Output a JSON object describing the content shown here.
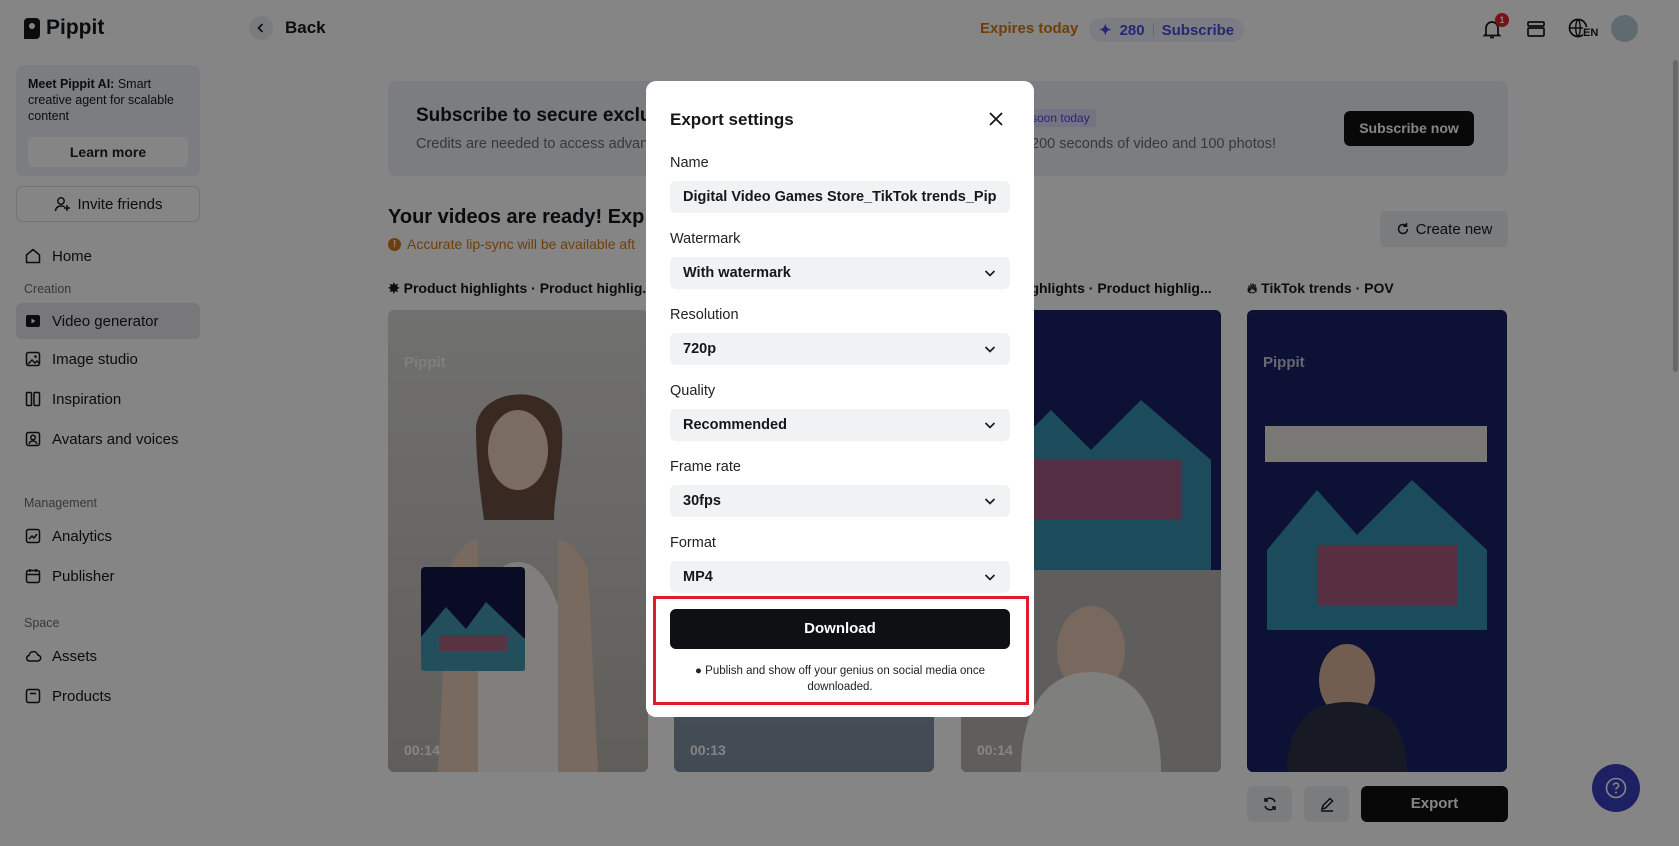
{
  "sidebar": {
    "logo": "Pippit",
    "promo": {
      "title_bold": "Meet Pippit AI:",
      "title_rest": " Smart creative agent for scalable content",
      "button": "Learn more"
    },
    "invite": "Invite friends",
    "home": "Home",
    "section_creation": "Creation",
    "video_generator": "Video generator",
    "image_studio": "Image studio",
    "inspiration": "Inspiration",
    "avatars_voices": "Avatars and voices",
    "section_management": "Management",
    "analytics": "Analytics",
    "publisher": "Publisher",
    "section_space": "Space",
    "assets": "Assets",
    "products": "Products"
  },
  "topbar": {
    "back": "Back",
    "expires": "Expires today",
    "credits": "280",
    "subscribe": "Subscribe",
    "notifications": "1",
    "language": "EN"
  },
  "banner": {
    "title": "Subscribe to secure exclus",
    "subtitle": "Credits are needed to access advan",
    "pill": "soon today",
    "subtitle2": "200 seconds of video and 100 photos!",
    "button": "Subscribe now"
  },
  "content": {
    "title": "Your videos are ready! Exp",
    "lip_note": "Accurate lip-sync will be available aft",
    "create_new": "Create new",
    "cards": [
      {
        "title": "Product highlights · Product highlig...",
        "duration": "00:14",
        "logo": "Pippit"
      },
      {
        "title": "",
        "duration": "00:13",
        "logo": ""
      },
      {
        "title": "highlights · Product highlig...",
        "duration": "00:14",
        "logo": ""
      },
      {
        "title": "TikTok trends · POV",
        "duration": "",
        "logo": "Pippit"
      }
    ],
    "export": "Export"
  },
  "modal": {
    "title": "Export settings",
    "name_label": "Name",
    "name_value": "Digital Video Games Store_TikTok trends_Pippit_",
    "watermark_label": "Watermark",
    "watermark_value": "With watermark",
    "resolution_label": "Resolution",
    "resolution_value": "720p",
    "quality_label": "Quality",
    "quality_value": "Recommended",
    "framerate_label": "Frame rate",
    "framerate_value": "30fps",
    "format_label": "Format",
    "format_value": "MP4",
    "download": "Download",
    "note": "Publish and show off your genius on social media once downloaded."
  },
  "colors": {
    "accent_orange": "#d57a12",
    "accent_purple": "#4a4bd6",
    "highlight_red": "#e01b2b",
    "dark": "#0f1014"
  }
}
